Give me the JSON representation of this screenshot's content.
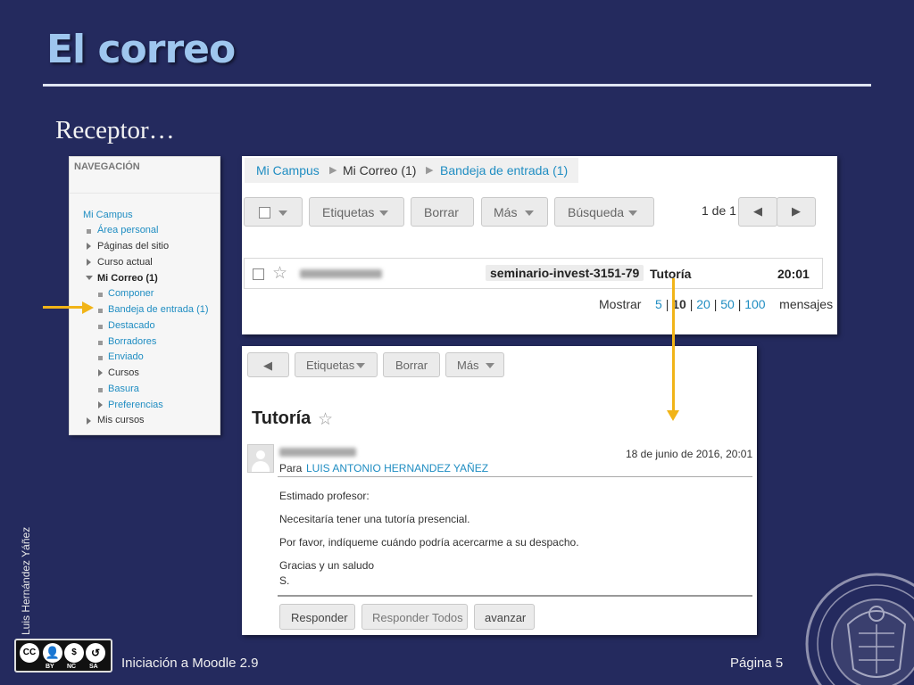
{
  "slide": {
    "title": "El correo",
    "subtitle": "Receptor…",
    "author": "Luis Hernández Yáñez",
    "course": "Iniciación a Moodle 2.9",
    "page": "Página 5",
    "license": {
      "cc": "CC",
      "by": "BY",
      "nc": "NC",
      "sa": "SA"
    }
  },
  "nav": {
    "header": "NAVEGACIÓN",
    "root": "Mi Campus",
    "items": [
      {
        "label": "Área personal"
      },
      {
        "label": "Páginas del sitio"
      },
      {
        "label": "Curso actual"
      },
      {
        "label": "Mi Correo (1)"
      },
      {
        "label": "Componer"
      },
      {
        "label": "Bandeja de entrada (1)"
      },
      {
        "label": "Destacado"
      },
      {
        "label": "Borradores"
      },
      {
        "label": "Enviado"
      },
      {
        "label": "Cursos"
      },
      {
        "label": "Basura"
      },
      {
        "label": "Preferencias"
      },
      {
        "label": "Mis cursos"
      }
    ]
  },
  "inbox": {
    "breadcrumb": [
      "Mi Campus",
      "Mi Correo (1)",
      "Bandeja de entrada (1)"
    ],
    "toolbar": {
      "etiquetas": "Etiquetas",
      "borrar": "Borrar",
      "mas": "Más",
      "busqueda": "Búsqueda",
      "page_count": "1 de 1",
      "prev_icon": "◀",
      "next_icon": "▶"
    },
    "message": {
      "tag": "seminario-invest-3151-79",
      "subject": "Tutoría",
      "time": "20:01"
    },
    "paging": {
      "prefix": "Mostrar",
      "options": [
        "5",
        "10",
        "20",
        "50",
        "100"
      ],
      "selected": "10",
      "suffix": "mensajes",
      "sep": "|"
    }
  },
  "message_view": {
    "toolbar": {
      "back_icon": "◀",
      "etiquetas": "Etiquetas",
      "borrar": "Borrar",
      "mas": "Más"
    },
    "title": "Tutoría",
    "date": "18 de junio de 2016, 20:01",
    "to_label": "Para",
    "recipient": "LUIS ANTONIO HERNANDEZ YAÑEZ",
    "body": [
      "Estimado profesor:",
      "Necesitaría tener una tutoría presencial.",
      "Por favor, indíqueme cuándo podría acercarme a su despacho.",
      "Gracias y un saludo",
      "S."
    ],
    "buttons": {
      "reply": "Responder",
      "reply_all": "Responder Todos",
      "forward": "avanzar"
    }
  },
  "colors": {
    "background": "#242a5e",
    "title": "#9ec6ee",
    "link": "#1f8dc2",
    "arrow": "#f1b418"
  }
}
